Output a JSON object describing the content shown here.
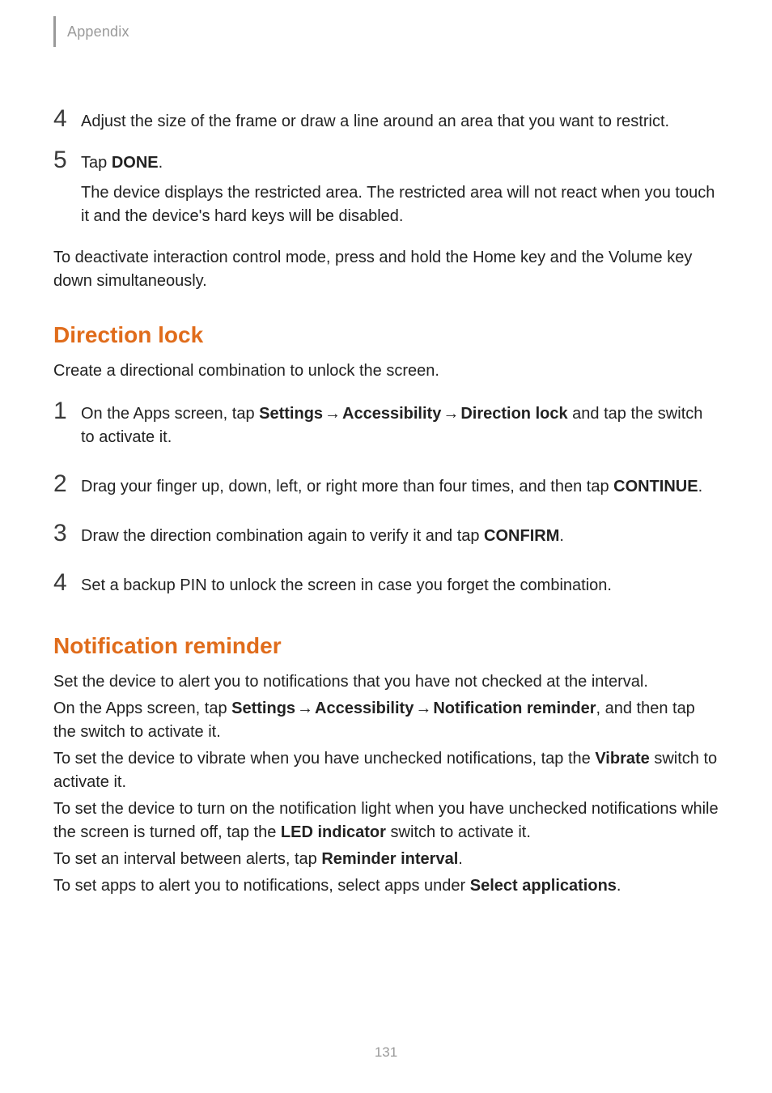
{
  "header": {
    "label": "Appendix"
  },
  "arrow": "→",
  "top_steps": [
    {
      "num": "4",
      "paras": [
        {
          "segments": [
            {
              "t": "Adjust the size of the frame or draw a line around an area that you want to restrict."
            }
          ]
        }
      ]
    },
    {
      "num": "5",
      "paras": [
        {
          "segments": [
            {
              "t": "Tap "
            },
            {
              "t": "DONE",
              "b": true
            },
            {
              "t": "."
            }
          ]
        },
        {
          "segments": [
            {
              "t": "The device displays the restricted area. The restricted area will not react when you touch it and the device's hard keys will be disabled."
            }
          ]
        }
      ]
    }
  ],
  "top_para": "To deactivate interaction control mode, press and hold the Home key and the Volume key down simultaneously.",
  "direction_lock": {
    "heading": "Direction lock",
    "intro": "Create a directional combination to unlock the screen.",
    "steps": [
      {
        "num": "1",
        "paras": [
          {
            "segments": [
              {
                "t": "On the Apps screen, tap "
              },
              {
                "t": "Settings",
                "b": true
              },
              {
                "t": " ",
                "arrow": true
              },
              {
                "t": "Accessibility",
                "b": true
              },
              {
                "t": " ",
                "arrow": true
              },
              {
                "t": "Direction lock",
                "b": true
              },
              {
                "t": " and tap the switch to activate it."
              }
            ]
          }
        ]
      },
      {
        "num": "2",
        "paras": [
          {
            "segments": [
              {
                "t": "Drag your finger up, down, left, or right more than four times, and then tap "
              },
              {
                "t": "CONTINUE",
                "b": true
              },
              {
                "t": "."
              }
            ]
          }
        ]
      },
      {
        "num": "3",
        "paras": [
          {
            "segments": [
              {
                "t": "Draw the direction combination again to verify it and tap "
              },
              {
                "t": "CONFIRM",
                "b": true
              },
              {
                "t": "."
              }
            ]
          }
        ]
      },
      {
        "num": "4",
        "paras": [
          {
            "segments": [
              {
                "t": "Set a backup PIN to unlock the screen in case you forget the combination."
              }
            ]
          }
        ]
      }
    ]
  },
  "notification_reminder": {
    "heading": "Notification reminder",
    "paras": [
      {
        "segments": [
          {
            "t": "Set the device to alert you to notifications that you have not checked at the interval."
          }
        ]
      },
      {
        "segments": [
          {
            "t": "On the Apps screen, tap "
          },
          {
            "t": "Settings",
            "b": true
          },
          {
            "t": " ",
            "arrow": true
          },
          {
            "t": "Accessibility",
            "b": true
          },
          {
            "t": " ",
            "arrow": true
          },
          {
            "t": "Notification reminder",
            "b": true
          },
          {
            "t": ", and then tap the switch to activate it."
          }
        ]
      },
      {
        "segments": [
          {
            "t": "To set the device to vibrate when you have unchecked notifications, tap the "
          },
          {
            "t": "Vibrate",
            "b": true
          },
          {
            "t": " switch to activate it."
          }
        ]
      },
      {
        "segments": [
          {
            "t": "To set the device to turn on the notification light when you have unchecked notifications while the screen is turned off, tap the "
          },
          {
            "t": "LED indicator",
            "b": true
          },
          {
            "t": " switch to activate it."
          }
        ]
      },
      {
        "segments": [
          {
            "t": "To set an interval between alerts, tap "
          },
          {
            "t": "Reminder interval",
            "b": true
          },
          {
            "t": "."
          }
        ]
      },
      {
        "segments": [
          {
            "t": "To set apps to alert you to notifications, select apps under "
          },
          {
            "t": "Select applications",
            "b": true
          },
          {
            "t": "."
          }
        ]
      }
    ]
  },
  "page_number": "131"
}
